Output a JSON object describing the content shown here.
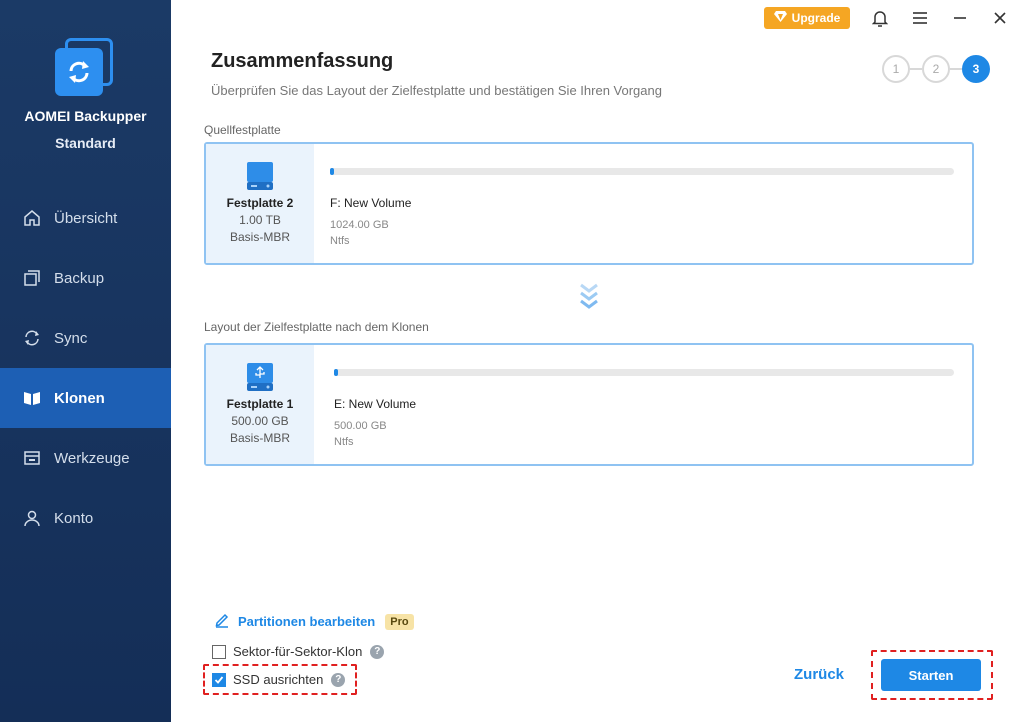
{
  "sidebar": {
    "brand_name": "AOMEI Backupper",
    "brand_edition": "Standard",
    "items": [
      {
        "label": "Übersicht",
        "icon": "home-icon"
      },
      {
        "label": "Backup",
        "icon": "backup-icon"
      },
      {
        "label": "Sync",
        "icon": "sync-icon"
      },
      {
        "label": "Klonen",
        "icon": "clone-icon",
        "active": true
      },
      {
        "label": "Werkzeuge",
        "icon": "tools-icon"
      },
      {
        "label": "Konto",
        "icon": "user-icon"
      }
    ]
  },
  "topbar": {
    "upgrade_label": "Upgrade"
  },
  "header": {
    "title": "Zusammenfassung",
    "subtitle": "Überprüfen Sie das Layout der Zielfestplatte und bestätigen Sie Ihren Vorgang",
    "steps": [
      "1",
      "2",
      "3"
    ],
    "current_step": 3
  },
  "source": {
    "section_label": "Quellfestplatte",
    "disk_name": "Festplatte 2",
    "disk_size": "1.00 TB",
    "disk_type": "Basis-MBR",
    "partition": {
      "name": "F: New Volume",
      "size": "1024.00 GB",
      "fs": "Ntfs"
    }
  },
  "target": {
    "section_label": "Layout der Zielfestplatte nach dem Klonen",
    "disk_name": "Festplatte 1",
    "disk_size": "500.00 GB",
    "disk_type": "Basis-MBR",
    "partition": {
      "name": "E: New Volume",
      "size": "500.00 GB",
      "fs": "Ntfs"
    }
  },
  "options": {
    "edit_partitions_label": "Partitionen bearbeiten",
    "pro_badge": "Pro",
    "sector_clone_label": "Sektor-für-Sektor-Klon",
    "sector_clone_checked": false,
    "ssd_align_label": "SSD ausrichten",
    "ssd_align_checked": true,
    "help_glyph": "?"
  },
  "footer": {
    "back_label": "Zurück",
    "start_label": "Starten"
  },
  "colors": {
    "sidebar_bg": "#17325c",
    "accent": "#1e88e5",
    "upgrade": "#f5a623",
    "highlight": "#e02020"
  }
}
